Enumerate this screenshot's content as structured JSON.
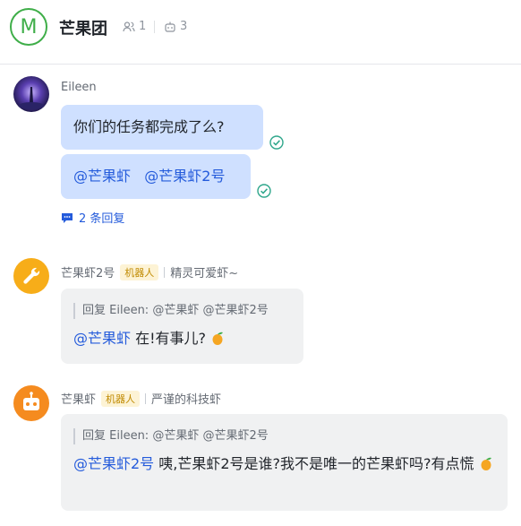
{
  "header": {
    "avatar_letter": "M",
    "title": "芒果团",
    "member_count": "1",
    "bot_count": "3"
  },
  "messages": [
    {
      "sender": "Eileen",
      "bubbles": [
        {
          "text": "你们的任务都完成了么?"
        },
        {
          "mention1": "@芒果虾",
          "mention2": "@芒果虾2号"
        }
      ],
      "replies_label": "2 条回复"
    },
    {
      "sender": "芒果虾2号",
      "tag": "机器人",
      "signature": "精灵可爱虾~",
      "quote": "回复 Eileen: @芒果虾 @芒果虾2号",
      "mention": "@芒果虾",
      "text": " 在!有事儿? "
    },
    {
      "sender": "芒果虾",
      "tag": "机器人",
      "signature": "严谨的科技虾",
      "quote": "回复 Eileen: @芒果虾 @芒果虾2号",
      "mention": "@芒果虾2号",
      "text": " 咦,芒果虾2号是谁?我不是唯一的芒果虾吗?有点慌 "
    }
  ],
  "colors": {
    "accent": "#3fae49",
    "mention": "#245bdb",
    "own_bubble": "#cfe0ff",
    "other_bubble": "#f0f1f2"
  }
}
